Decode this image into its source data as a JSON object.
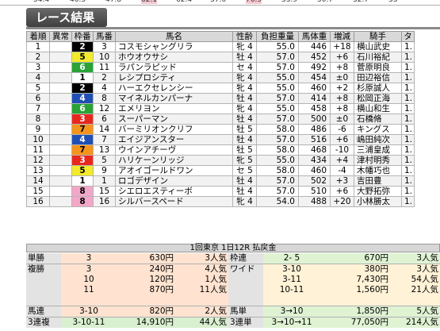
{
  "top_strip": [
    "54.4",
    "46.3",
    "47.8",
    "62.1",
    "62.4",
    "37.6",
    "76.9",
    "33.9",
    "50.7",
    "32.7",
    "33"
  ],
  "section_title": "レース結果",
  "results": {
    "columns": [
      "着順",
      "異常",
      "枠番",
      "馬番",
      "馬名",
      "性齢",
      "負担重量",
      "馬体重",
      "増減",
      "騎手",
      "タ"
    ],
    "rows": [
      {
        "pos": "1",
        "abn": "",
        "waku": "2",
        "num": "3",
        "name": "コスモシャングリラ",
        "sexage": "牝 4",
        "weight": "55.0",
        "body": "446",
        "diff": "+18",
        "jockey": "横山武史",
        "t": "1."
      },
      {
        "pos": "2",
        "abn": "",
        "waku": "5",
        "num": "10",
        "name": "ホウオウサシ",
        "sexage": "牡 4",
        "weight": "57.0",
        "body": "452",
        "diff": "+6",
        "jockey": "石川裕紀",
        "t": "1."
      },
      {
        "pos": "3",
        "abn": "",
        "waku": "6",
        "num": "11",
        "name": "ラパンラピッド",
        "sexage": "セ 4",
        "weight": "57.0",
        "body": "492",
        "diff": "+8",
        "jockey": "菅原明良",
        "t": "1."
      },
      {
        "pos": "4",
        "abn": "",
        "waku": "1",
        "num": "2",
        "name": "レシプロシティ",
        "sexage": "牝 4",
        "weight": "55.0",
        "body": "454",
        "diff": "±0",
        "jockey": "田辺裕信",
        "t": "1."
      },
      {
        "pos": "5",
        "abn": "",
        "waku": "2",
        "num": "4",
        "name": "ハーエクセレンシー",
        "sexage": "牝 4",
        "weight": "55.0",
        "body": "460",
        "diff": "+2",
        "jockey": "杉原誠人",
        "t": "1."
      },
      {
        "pos": "6",
        "abn": "",
        "waku": "4",
        "num": "8",
        "name": "マイネルカンパーナ",
        "sexage": "牡 4",
        "weight": "57.0",
        "body": "414",
        "diff": "+8",
        "jockey": "松岡正海",
        "t": "1."
      },
      {
        "pos": "7",
        "abn": "",
        "waku": "6",
        "num": "12",
        "name": "エメリヨン",
        "sexage": "牝 4",
        "weight": "55.0",
        "body": "458",
        "diff": "+8",
        "jockey": "横山和生",
        "t": "1."
      },
      {
        "pos": "8",
        "abn": "",
        "waku": "3",
        "num": "6",
        "name": "スーパーマン",
        "sexage": "牡 4",
        "weight": "57.0",
        "body": "500",
        "diff": "±0",
        "jockey": "石橋脩",
        "t": "1."
      },
      {
        "pos": "9",
        "abn": "",
        "waku": "7",
        "num": "14",
        "name": "バーミリオンクリフ",
        "sexage": "牡 5",
        "weight": "58.0",
        "body": "486",
        "diff": "-6",
        "jockey": "キングス",
        "t": "1."
      },
      {
        "pos": "10",
        "abn": "",
        "waku": "4",
        "num": "7",
        "name": "エイジアンスター",
        "sexage": "牡 4",
        "weight": "57.0",
        "body": "516",
        "diff": "+6",
        "jockey": "嶋田純次",
        "t": "1."
      },
      {
        "pos": "11",
        "abn": "",
        "waku": "7",
        "num": "13",
        "name": "ウインアチーヴ",
        "sexage": "牡 5",
        "weight": "58.0",
        "body": "468",
        "diff": "-10",
        "jockey": "三浦皇成",
        "t": "1."
      },
      {
        "pos": "12",
        "abn": "",
        "waku": "3",
        "num": "5",
        "name": "ハリケーンリッジ",
        "sexage": "牝 5",
        "weight": "55.0",
        "body": "434",
        "diff": "+4",
        "jockey": "津村明秀",
        "t": "1."
      },
      {
        "pos": "13",
        "abn": "",
        "waku": "5",
        "num": "9",
        "name": "アオイゴールドワン",
        "sexage": "セ 5",
        "weight": "58.0",
        "body": "460",
        "diff": "-4",
        "jockey": "木幡巧也",
        "t": "1."
      },
      {
        "pos": "14",
        "abn": "",
        "waku": "1",
        "num": "1",
        "name": "ロゴデザイン",
        "sexage": "牡 4",
        "weight": "57.0",
        "body": "502",
        "diff": "+3",
        "jockey": "吉田豊",
        "t": "1."
      },
      {
        "pos": "15",
        "abn": "",
        "waku": "8",
        "num": "15",
        "name": "シエロエスティーボ",
        "sexage": "牡 4",
        "weight": "57.0",
        "body": "510",
        "diff": "+6",
        "jockey": "大野拓弥",
        "t": "1."
      },
      {
        "pos": "16",
        "abn": "",
        "waku": "8",
        "num": "16",
        "name": "シルバースペード",
        "sexage": "牝 4",
        "weight": "54.0",
        "body": "488",
        "diff": "+20",
        "jockey": "小林勝太",
        "t": "1."
      }
    ]
  },
  "waku_colors": {
    "1": {
      "bg": "#ffffff",
      "fg": "#000000"
    },
    "2": {
      "bg": "#000000",
      "fg": "#ffffff"
    },
    "3": {
      "bg": "#e8271f",
      "fg": "#ffffff"
    },
    "4": {
      "bg": "#1f4fb4",
      "fg": "#ffffff"
    },
    "5": {
      "bg": "#f2ea2a",
      "fg": "#000000"
    },
    "6": {
      "bg": "#29a336",
      "fg": "#ffffff"
    },
    "7": {
      "bg": "#f5941d",
      "fg": "#000000"
    },
    "8": {
      "bg": "#f3a7c8",
      "fg": "#000000"
    }
  },
  "payout": {
    "title": "1回東京 1日12R 払戻金",
    "left": [
      {
        "kind": "単勝",
        "combo": "3",
        "amount": "630円",
        "pop": "3人気"
      },
      {
        "kind": "複勝",
        "combo": "3",
        "amount": "240円",
        "pop": "4人気"
      },
      {
        "kind": "",
        "combo": "10",
        "amount": "120円",
        "pop": "1人気"
      },
      {
        "kind": "",
        "combo": "11",
        "amount": "870円",
        "pop": "11人気"
      },
      {
        "kind": "",
        "combo": "",
        "amount": "",
        "pop": ""
      },
      {
        "kind": "馬連",
        "combo": "3-10",
        "amount": "820円",
        "pop": "2人気"
      },
      {
        "kind": "3連複",
        "combo": "3-10-11",
        "amount": "14,910円",
        "pop": "44人気"
      }
    ],
    "right": [
      {
        "kind": "枠連",
        "combo": "2- 5",
        "amount": "670円",
        "pop": "3人気"
      },
      {
        "kind": "ワイド",
        "combo": "3-10",
        "amount": "380円",
        "pop": "3人気"
      },
      {
        "kind": "",
        "combo": "3-11",
        "amount": "7,430円",
        "pop": "54人気"
      },
      {
        "kind": "",
        "combo": "10-11",
        "amount": "1,560円",
        "pop": "21人気"
      },
      {
        "kind": "",
        "combo": "",
        "amount": "",
        "pop": ""
      },
      {
        "kind": "馬単",
        "combo": "3→10",
        "amount": "1,850円",
        "pop": "5人気"
      },
      {
        "kind": "3連単",
        "combo": "3→10→11",
        "amount": "77,050円",
        "pop": "214人気"
      }
    ]
  }
}
